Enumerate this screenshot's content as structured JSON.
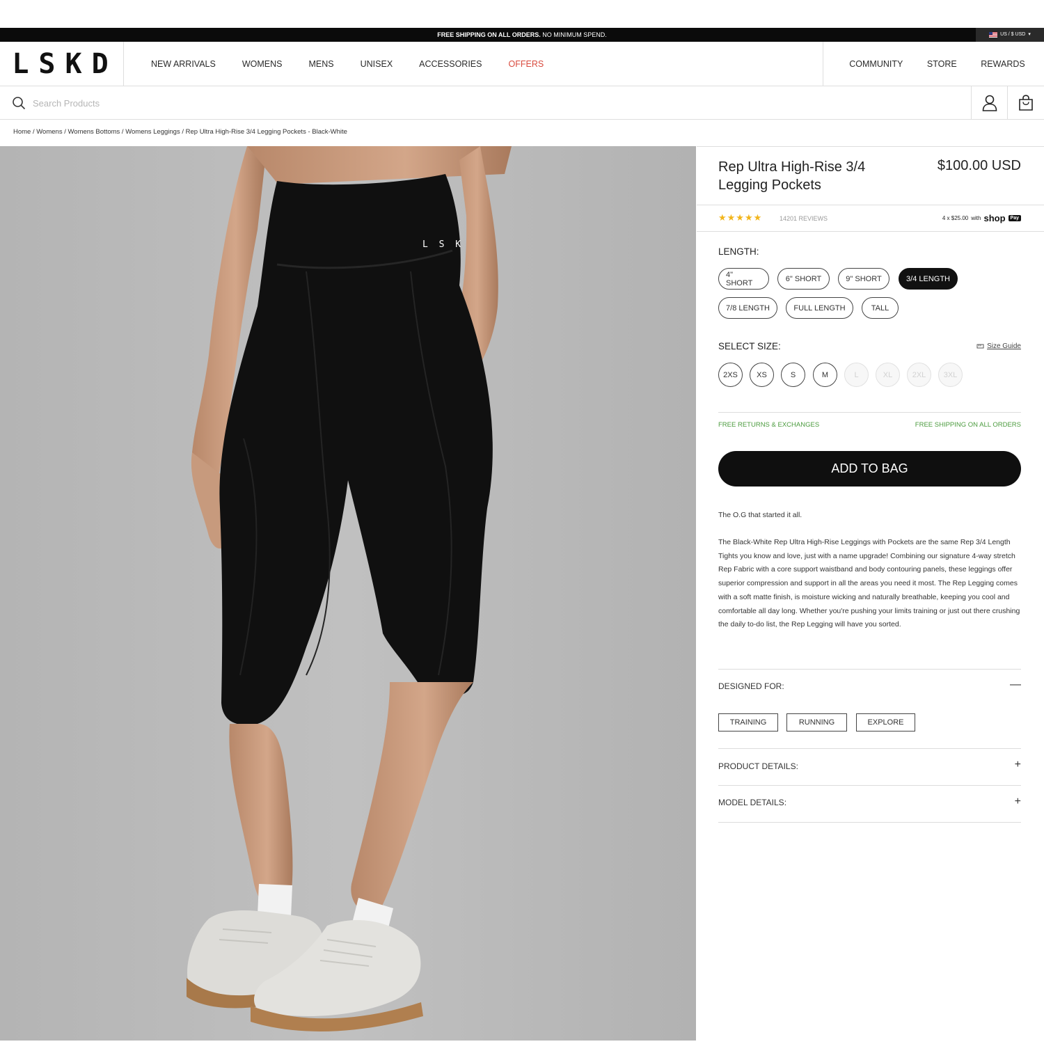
{
  "promo": {
    "text_bold": "FREE SHIPPING ON ALL ORDERS.",
    "text": " NO MINIMUM SPEND.",
    "locale": "US / $ USD"
  },
  "brand": {
    "logo": "LSKD"
  },
  "nav": {
    "left": [
      "NEW ARRIVALS",
      "WOMENS",
      "MENS",
      "UNISEX",
      "ACCESSORIES",
      "OFFERS"
    ],
    "right": [
      "COMMUNITY",
      "STORE",
      "REWARDS"
    ]
  },
  "search": {
    "placeholder": "Search Products"
  },
  "breadcrumb": "Home / Womens / Womens Bottoms / Womens Leggings / Rep Ultra High-Rise 3/4 Legging Pockets - Black-White",
  "product": {
    "title": "Rep Ultra High-Rise 3/4 Legging Pockets",
    "price": "$100.00 USD",
    "rating": 5,
    "stars": "★★★★★",
    "reviews": "14201 REVIEWS",
    "shoppay": {
      "installments": "4 x $25.00",
      "with": "with",
      "shop": "shop",
      "pay": "Pay"
    }
  },
  "length": {
    "label": "LENGTH:",
    "options": [
      "4\" SHORT",
      "6\" SHORT",
      "9\" SHORT",
      "3/4 LENGTH",
      "7/8 LENGTH",
      "FULL LENGTH",
      "TALL"
    ],
    "selected": "3/4 LENGTH"
  },
  "sizes": {
    "label": "SELECT SIZE:",
    "guide": "Size Guide",
    "options": [
      "2XS",
      "XS",
      "S",
      "M",
      "L",
      "XL",
      "2XL",
      "3XL"
    ],
    "out_of_stock": [
      "L",
      "XL",
      "2XL",
      "3XL"
    ]
  },
  "perks": {
    "returns": "FREE RETURNS & EXCHANGES",
    "shipping": "FREE SHIPPING ON ALL ORDERS"
  },
  "cta": {
    "add_to_bag": "ADD TO BAG"
  },
  "description": {
    "intro": "The O.G that started it all.",
    "body": "The Black-White Rep Ultra High-Rise Leggings with Pockets are the same Rep 3/4 Length Tights you know and love, just with a name upgrade! Combining our signature 4-way stretch Rep Fabric with a core support waistband and body contouring panels, these leggings offer superior compression and support in all the areas you need it most. The Rep Legging comes with a soft matte finish, is moisture wicking and naturally breathable, keeping you cool and comfortable all day long. Whether you're pushing your limits training or just out there crushing the daily to-do list, the Rep Legging will have you sorted."
  },
  "accordions": {
    "designed_for": {
      "title": "DESIGNED FOR:",
      "toggle": "—",
      "tags": [
        "TRAINING",
        "RUNNING",
        "EXPLORE"
      ]
    },
    "product_details": {
      "title": "PRODUCT DETAILS:",
      "toggle": "+"
    },
    "model_details": {
      "title": "MODEL DETAILS:",
      "toggle": "+"
    }
  },
  "image": {
    "waistband_logo": "L S K"
  },
  "colors": {
    "accent": "#0f0f0f",
    "offers": "#d94a3d",
    "stars": "#f2b51b",
    "perks": "#4b9b3e",
    "photo_bg": "#b9b9b9"
  }
}
